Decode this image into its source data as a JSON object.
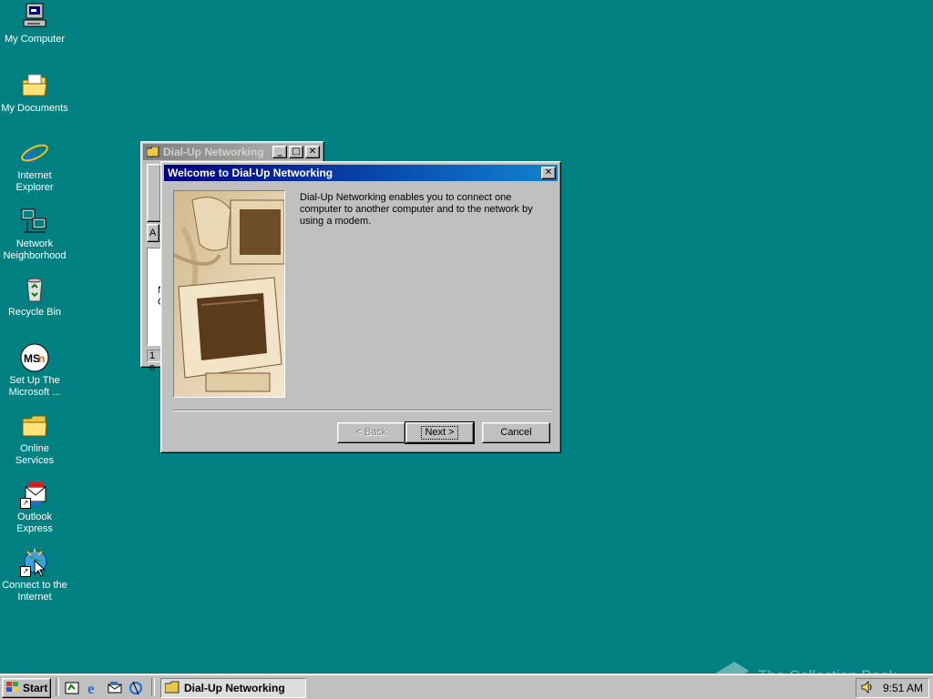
{
  "desktop": {
    "icons": [
      {
        "label": "My Computer"
      },
      {
        "label": "My Documents"
      },
      {
        "label": "Internet\nExplorer"
      },
      {
        "label": "Network\nNeighborhood"
      },
      {
        "label": "Recycle Bin"
      },
      {
        "label": "Set Up The\nMicrosoft ..."
      },
      {
        "label": "Online\nServices"
      },
      {
        "label": "Outlook\nExpress"
      },
      {
        "label": "Connect to the\nInternet"
      }
    ],
    "background_color": "#008080"
  },
  "back_window": {
    "title": "Dial-Up Networking",
    "partial_texts": [
      "A",
      "N",
      "C",
      "1 o"
    ]
  },
  "dialog": {
    "title": "Welcome to Dial-Up Networking",
    "intro": "Dial-Up Networking enables you to connect one computer to another computer and to the network by using a modem.",
    "buttons": {
      "back": "< Back",
      "next": "Next >",
      "cancel": "Cancel"
    },
    "title_color": "#000080"
  },
  "taskbar": {
    "start_label": "Start",
    "quick_launch": [
      "show-desktop-icon",
      "internet-explorer-icon",
      "outlook-express-icon",
      "channels-icon"
    ],
    "tasks": [
      {
        "label": "Dial-Up Networking",
        "active": true
      }
    ],
    "clock": "9:51 AM",
    "tray_icons": [
      "volume-icon"
    ]
  },
  "watermark": {
    "text": "The Collection Book"
  }
}
